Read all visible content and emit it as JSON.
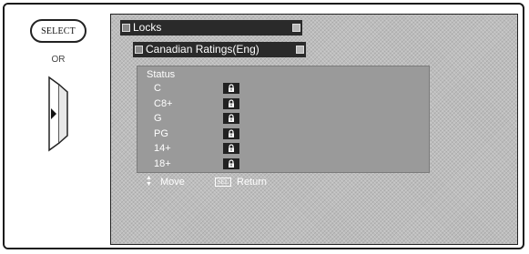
{
  "controls": {
    "select_label": "SELECT",
    "or_label": "OR"
  },
  "menu": {
    "title": "Locks",
    "subtitle": "Canadian Ratings(Eng)",
    "status_header": "Status",
    "ratings": [
      {
        "label": "C",
        "locked": true
      },
      {
        "label": "C8+",
        "locked": true
      },
      {
        "label": "G",
        "locked": true
      },
      {
        "label": "PG",
        "locked": true
      },
      {
        "label": "14+",
        "locked": true
      },
      {
        "label": "18+",
        "locked": true
      }
    ],
    "footer": {
      "move_label": "Move",
      "sel_key": "SEL",
      "return_label": "Return"
    }
  },
  "colors": {
    "screen_bg": "#bdbdbd",
    "bar_bg": "#2a2a2a",
    "panel_bg": "#9a9a9a"
  }
}
